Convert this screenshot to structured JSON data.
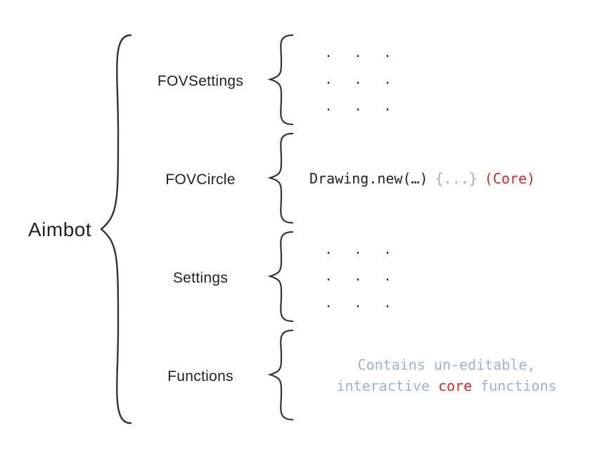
{
  "root": {
    "label": "Aimbot"
  },
  "children": [
    {
      "label": "FOVSettings",
      "kind": "dots"
    },
    {
      "label": "FOVCircle",
      "kind": "code",
      "code": "Drawing.new(…)",
      "braces": "{...}",
      "tag": "(Core)"
    },
    {
      "label": "Settings",
      "kind": "dots"
    },
    {
      "label": "Functions",
      "kind": "text",
      "line1_before": "Contains un-editable,",
      "line2_before": "interactive ",
      "line2_highlight": "core",
      "line2_after": " functions"
    }
  ],
  "dot": "."
}
